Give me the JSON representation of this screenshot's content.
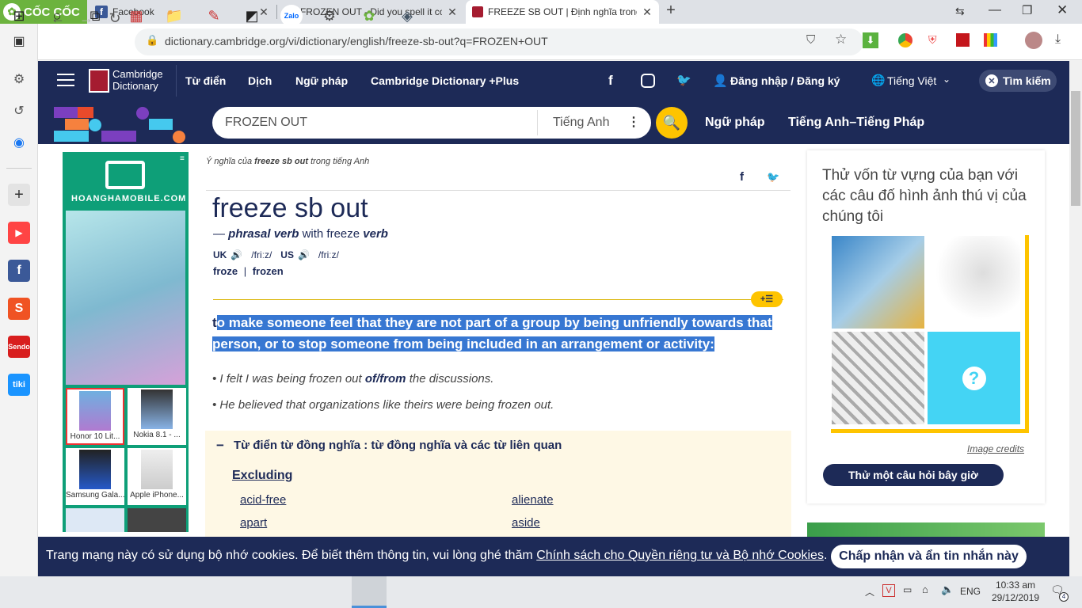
{
  "browser": {
    "brand": "CỐC CỐC",
    "tabs": [
      {
        "title": "Facebook"
      },
      {
        "title": "FROZEN OUT - Did you spell it cor"
      },
      {
        "title": "FREEZE SB OUT | Định nghĩa trong"
      }
    ],
    "new_tab": "+",
    "url": "dictionary.cambridge.org/vi/dictionary/english/freeze-sb-out?q=FROZEN+OUT"
  },
  "header": {
    "logo_line1": "Cambridge",
    "logo_line2": "Dictionary",
    "nav": [
      "Từ điển",
      "Dịch",
      "Ngữ pháp",
      "Cambridge Dictionary +Plus"
    ],
    "login": "Đăng nhập / Đăng ký",
    "language": "Tiếng Việt",
    "search_button": "Tìm kiếm"
  },
  "search": {
    "value": "FROZEN OUT",
    "dict": "Tiếng Anh",
    "links": [
      "Ngữ pháp",
      "Tiếng Anh–Tiếng Pháp"
    ]
  },
  "ad": {
    "brand": "HOANGHAMOBILE.COM",
    "phones": [
      "Honor 10 Lit...",
      "Nokia 8.1 - ...",
      "Samsung Gala...",
      "Apple iPhone..."
    ]
  },
  "entry": {
    "meaning_prefix": "Ý nghĩa của",
    "meaning_word": "freeze sb out",
    "meaning_suffix": "trong tiếng Anh",
    "headword": "freeze sb out",
    "pos_dash": "—",
    "pos": "phrasal verb",
    "pos_with": "with freeze",
    "pos_verb": "verb",
    "uk": "UK",
    "uk_ipa": "/friːz/",
    "us": "US",
    "us_ipa": "/friːz/",
    "forms": [
      "froze",
      "frozen"
    ],
    "forms_sep": "|",
    "def_first": "t",
    "definition": "o make someone feel that they are not part of a group by being unfriendly towards that person, or to stop someone from being included in an arrangement or activity:",
    "examples": [
      {
        "pre": "I felt I was being frozen out ",
        "bold": "of/from",
        "post": " the discussions."
      },
      {
        "pre": "He believed that organizations like theirs were being frozen out.",
        "bold": "",
        "post": ""
      }
    ],
    "thesaurus_title": "Từ điển từ đồng nghĩa : từ đồng nghĩa và các từ liên quan",
    "thesaurus_group": "Excluding",
    "synonyms_left": [
      "acid-free",
      "apart"
    ],
    "synonyms_right": [
      "alienate",
      "aside"
    ]
  },
  "quiz": {
    "title": "Thử vốn từ vựng của bạn với các câu đố hình ảnh thú vị của chúng tôi",
    "credits": "Image credits",
    "button": "Thử một câu hỏi bây giờ",
    "question_mark": "?"
  },
  "cookie": {
    "text": "Trang mạng này có sử dụng bộ nhớ cookies. Để biết thêm thông tin, vui lòng ghé thăm ",
    "link": "Chính sách cho Quyền riêng tư và Bộ nhớ Cookies",
    "end": ".",
    "accept": "Chấp nhận và ẩn tin nhắn này"
  },
  "taskbar": {
    "time": "10:33 am",
    "date": "29/12/2019",
    "lang": "ENG",
    "notif_count": "4"
  },
  "colors": {
    "navy": "#1d2a57",
    "yellow": "#fec400",
    "highlight": "#3777d2"
  }
}
